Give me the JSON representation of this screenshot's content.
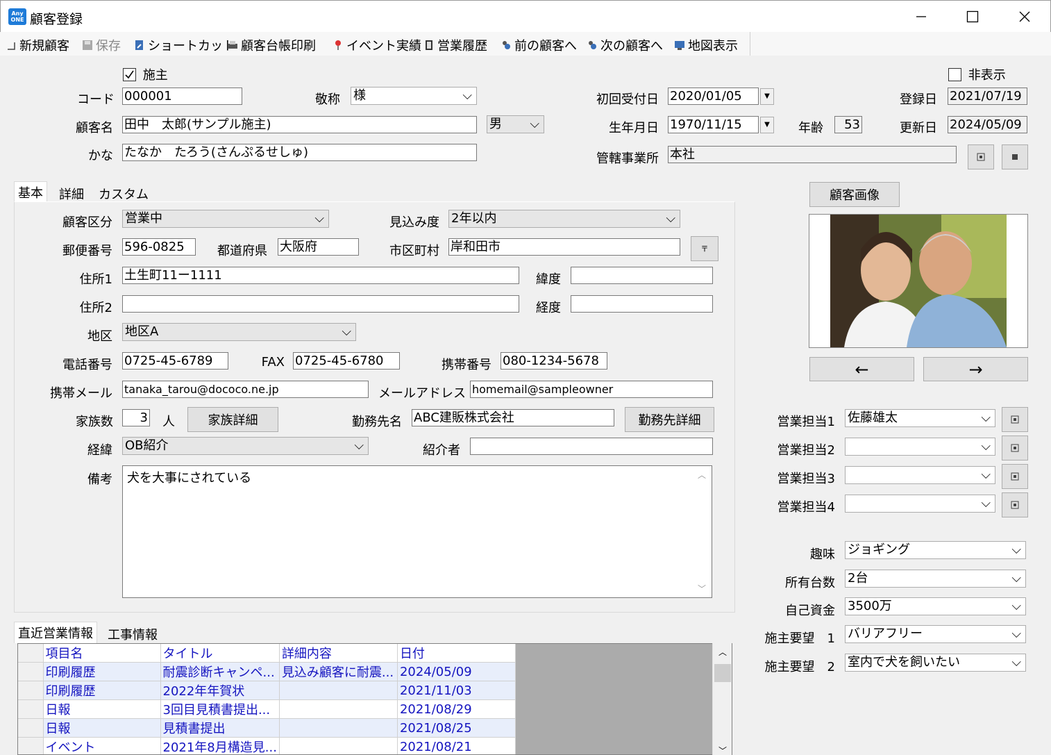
{
  "window": {
    "title": "顧客登録",
    "app_icon_text": "Any ONE"
  },
  "toolbar": {
    "new": "新規顧客",
    "save": "保存",
    "shortcut": "ショートカット",
    "print": "顧客台帳印刷",
    "events": "イベント実績",
    "history": "営業履歴",
    "prev": "前の顧客へ",
    "next": "次の顧客へ",
    "map": "地図表示"
  },
  "header": {
    "owner_label": "施主",
    "owner_checked": true,
    "hidden_label": "非表示",
    "hidden_checked": false,
    "code_label": "コード",
    "code": "000001",
    "honorific_label": "敬称",
    "honorific": "様",
    "name_label": "顧客名",
    "name": "田中　太郎(サンプル施主)",
    "gender": "男",
    "kana_label": "かな",
    "kana": "たなか　たろう(さんぷるせしゅ)",
    "first_contact_label": "初回受付日",
    "first_contact": "2020/01/05",
    "birth_label": "生年月日",
    "birth": "1970/11/15",
    "age_label": "年齢",
    "age": "53",
    "office_label": "管轄事業所",
    "office": "本社",
    "registered_label": "登録日",
    "registered": "2021/07/19 1",
    "updated_label": "更新日",
    "updated": "2024/05/09 1"
  },
  "tabs": [
    "基本",
    "詳細",
    "カスタム"
  ],
  "basic": {
    "category_label": "顧客区分",
    "category": "営業中",
    "prospect_label": "見込み度",
    "prospect": "2年以内",
    "zip_label": "郵便番号",
    "zip": "596-0825",
    "pref_label": "都道府県",
    "pref": "大阪府",
    "city_label": "市区町村",
    "city": "岸和田市",
    "addr1_label": "住所1",
    "addr1": "土生町11ー1111",
    "lat_label": "緯度",
    "lat": "",
    "addr2_label": "住所2",
    "addr2": "",
    "lng_label": "経度",
    "lng": "",
    "area_label": "地区",
    "area": "地区A",
    "phone_label": "電話番号",
    "phone": "0725-45-6789",
    "fax_label": "FAX",
    "fax": "0725-45-6780",
    "mobile_label": "携帯番号",
    "mobile": "080-1234-5678",
    "mobile_mail_label": "携帯メール",
    "mobile_mail": "tanaka_tarou@dococo.ne.jp",
    "mail_label": "メールアドレス",
    "mail": "homemail@sampleowner",
    "family_label": "家族数",
    "family": "3",
    "family_unit": "人",
    "family_button": "家族詳細",
    "employer_label": "勤務先名",
    "employer": "ABC建販株式会社",
    "employer_button": "勤務先詳細",
    "route_label": "経緯",
    "route": "OB紹介",
    "referrer_label": "紹介者",
    "referrer": "",
    "notes_label": "備考",
    "notes": "犬を大事にされている"
  },
  "right": {
    "image_button": "顧客画像",
    "prev_arrow": "←",
    "next_arrow": "→",
    "sales": [
      {
        "label": "営業担当1",
        "value": "佐藤雄太"
      },
      {
        "label": "営業担当2",
        "value": ""
      },
      {
        "label": "営業担当3",
        "value": ""
      },
      {
        "label": "営業担当4",
        "value": ""
      }
    ],
    "hobby_label": "趣味",
    "hobby": "ジョギング",
    "cars_label": "所有台数",
    "cars": "2台",
    "funds_label": "自己資金",
    "funds": "3500万",
    "req1_label": "施主要望　1",
    "req1": "バリアフリー",
    "req2_label": "施主要望　2",
    "req2": "室内で犬を飼いたい"
  },
  "bottom_tabs": [
    "直近営業情報",
    "工事情報"
  ],
  "grid": {
    "headers": [
      "項目名",
      "タイトル",
      "詳細内容",
      "日付"
    ],
    "rows": [
      [
        "印刷履歴",
        "耐震診断キャンペ...",
        "見込み顧客に耐震...",
        "2024/05/09"
      ],
      [
        "印刷履歴",
        "2022年年賀状",
        "",
        "2021/11/03"
      ],
      [
        "日報",
        "3回目見積書提出...",
        "",
        "2021/08/29"
      ],
      [
        "日報",
        "見積書提出",
        "",
        "2021/08/25"
      ],
      [
        "イベント",
        "2021年8月構造見...",
        "",
        "2021/08/21"
      ]
    ]
  }
}
